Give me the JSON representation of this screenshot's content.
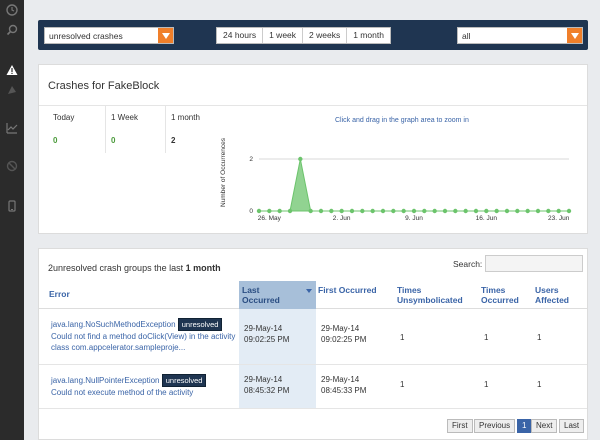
{
  "nav": {
    "icons": [
      "clock-icon",
      "search-icon",
      "warning-icon",
      "palette-icon",
      "chart-icon",
      "bug-icon",
      "device-icon"
    ]
  },
  "filters": {
    "crash_type": "unresolved crashes",
    "ranges": [
      "24 hours",
      "1 week",
      "2 weeks",
      "1 month"
    ],
    "selected_range": "1 month",
    "scope": "all"
  },
  "summary": {
    "title": "Crashes for FakeBlock",
    "stats": [
      {
        "label": "Today",
        "value": "0"
      },
      {
        "label": "1 Week",
        "value": "0"
      },
      {
        "label": "1 month",
        "value": "2"
      }
    ],
    "graph_note": "Click and drag in the graph area to zoom in"
  },
  "chart_data": {
    "type": "area",
    "ylabel": "Number of Occurrences",
    "ylim": [
      0,
      2
    ],
    "yticks": [
      "0",
      "2"
    ],
    "xtick_labels": [
      "26. May",
      "2. Jun",
      "9. Jun",
      "16. Jun",
      "23. Jun"
    ],
    "x": [
      "25 May",
      "26 May",
      "27 May",
      "28 May",
      "29 May",
      "30 May",
      "31 May",
      "1 Jun",
      "2 Jun",
      "3 Jun",
      "4 Jun",
      "5 Jun",
      "6 Jun",
      "7 Jun",
      "8 Jun",
      "9 Jun",
      "10 Jun",
      "11 Jun",
      "12 Jun",
      "13 Jun",
      "14 Jun",
      "15 Jun",
      "16 Jun",
      "17 Jun",
      "18 Jun",
      "19 Jun",
      "20 Jun",
      "21 Jun",
      "22 Jun",
      "23 Jun",
      "24 Jun"
    ],
    "series": [
      {
        "values": [
          0,
          0,
          0,
          0,
          2,
          0,
          0,
          0,
          0,
          0,
          0,
          0,
          0,
          0,
          0,
          0,
          0,
          0,
          0,
          0,
          0,
          0,
          0,
          0,
          0,
          0,
          0,
          0,
          0,
          0,
          0
        ]
      }
    ],
    "color": "#6cc46c"
  },
  "crashes": {
    "title_count": "2",
    "title_text": "unresolved crash groups the last",
    "title_period": "1 month",
    "search_label": "Search:",
    "columns": {
      "error": "Error",
      "last": "Last Occurred",
      "first": "First Occurred",
      "unsym": "Times Unsymbolicated",
      "times": "Times Occurred",
      "users": "Users Affected"
    },
    "rows": [
      {
        "error": "java.lang.NoSuchMethodException",
        "status": "unresolved",
        "detail": "Could not find a method doClick(View) in the activity class com.appcelerator.sampleproje...",
        "last_date": "29-May-14",
        "last_time": "09:02:25 PM",
        "first_date": "29-May-14",
        "first_time": "09:02:25 PM",
        "unsym": "1",
        "times": "1",
        "users": "1"
      },
      {
        "error": "java.lang.NullPointerException",
        "status": "unresolved",
        "detail": "Could not execute method of the activity",
        "last_date": "29-May-14",
        "last_time": "08:45:32 PM",
        "first_date": "29-May-14",
        "first_time": "08:45:33 PM",
        "unsym": "1",
        "times": "1",
        "users": "1"
      }
    ],
    "pager": {
      "first": "First",
      "prev": "Previous",
      "page": "1",
      "next": "Next",
      "last": "Last"
    }
  }
}
